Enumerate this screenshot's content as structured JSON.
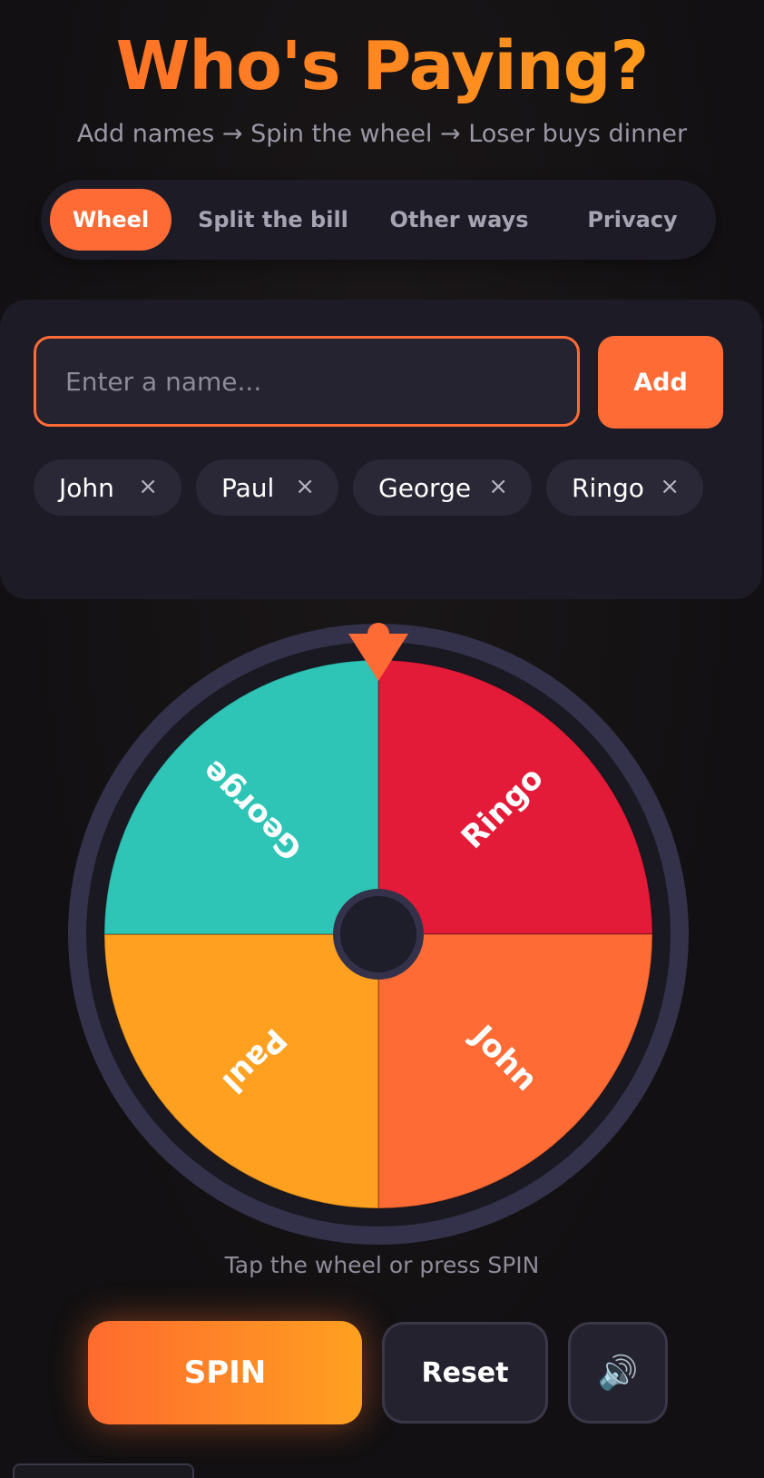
{
  "header": {
    "title": "Who's Paying?",
    "subtitle": "Add names → Spin the wheel → Loser buys dinner"
  },
  "tabs": [
    {
      "label": "Wheel",
      "active": true
    },
    {
      "label": "Split the bill",
      "active": false
    },
    {
      "label": "Other ways",
      "active": false
    },
    {
      "label": "Privacy",
      "active": false
    }
  ],
  "input": {
    "placeholder": "Enter a name...",
    "value": "",
    "add_label": "Add"
  },
  "chips": [
    {
      "name": "John",
      "remove": "×"
    },
    {
      "name": "Paul",
      "remove": "×"
    },
    {
      "name": "George",
      "remove": "×"
    },
    {
      "name": "Ringo",
      "remove": "×"
    }
  ],
  "wheel": {
    "segments": [
      {
        "name": "Ringo",
        "color": "#e31b38"
      },
      {
        "name": "John",
        "color": "#ff6b35"
      },
      {
        "name": "Paul",
        "color": "#ffa020"
      },
      {
        "name": "George",
        "color": "#2ec4b6"
      }
    ],
    "rim_color": "#34324a",
    "pointer_color": "#ff6b35"
  },
  "hint": "Tap the wheel or press SPIN",
  "controls": {
    "spin_label": "SPIN",
    "reset_label": "Reset",
    "sound_icon": "🔊"
  },
  "colors": {
    "accent": "#ff6b35",
    "panel": "#1c1b26",
    "background": "#141214"
  }
}
